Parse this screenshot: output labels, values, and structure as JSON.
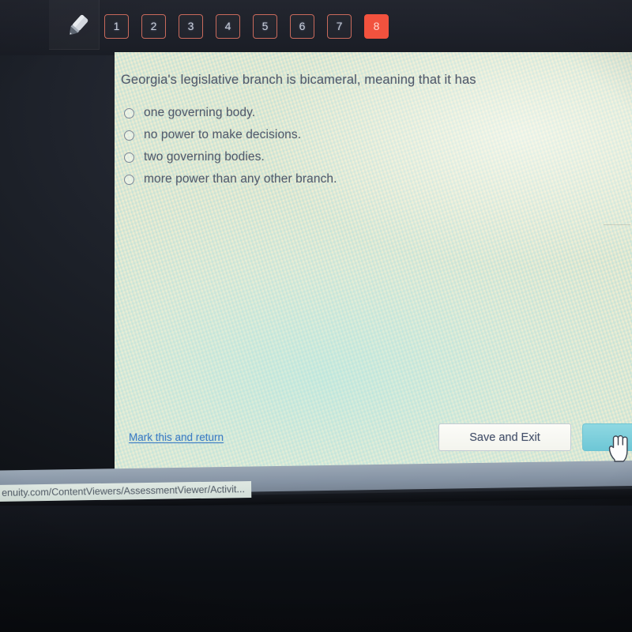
{
  "toolbar": {
    "pencil_tool_name": "highlighter-pencil-icon",
    "questions": [
      {
        "label": "1",
        "active": false
      },
      {
        "label": "2",
        "active": false
      },
      {
        "label": "3",
        "active": false
      },
      {
        "label": "4",
        "active": false
      },
      {
        "label": "5",
        "active": false
      },
      {
        "label": "6",
        "active": false
      },
      {
        "label": "7",
        "active": false
      },
      {
        "label": "8",
        "active": true
      }
    ],
    "active_color": "#f2523e",
    "inactive_border_color": "#c96a5c"
  },
  "question": {
    "text": "Georgia's legislative branch is bicameral, meaning that it has",
    "options": [
      {
        "label": "one governing body.",
        "selected": false
      },
      {
        "label": "no power to make decisions.",
        "selected": false
      },
      {
        "label": "two governing bodies.",
        "selected": false
      },
      {
        "label": "more power than any other branch.",
        "selected": false
      }
    ]
  },
  "actions": {
    "mark_link": "Mark this and return",
    "save_exit": "Save and Exit",
    "next": "",
    "link_color": "#3f7ec4",
    "next_color": "#7ccfdc"
  },
  "status_bar": {
    "url": "enuity.com/ContentViewers/AssessmentViewer/Activit..."
  }
}
